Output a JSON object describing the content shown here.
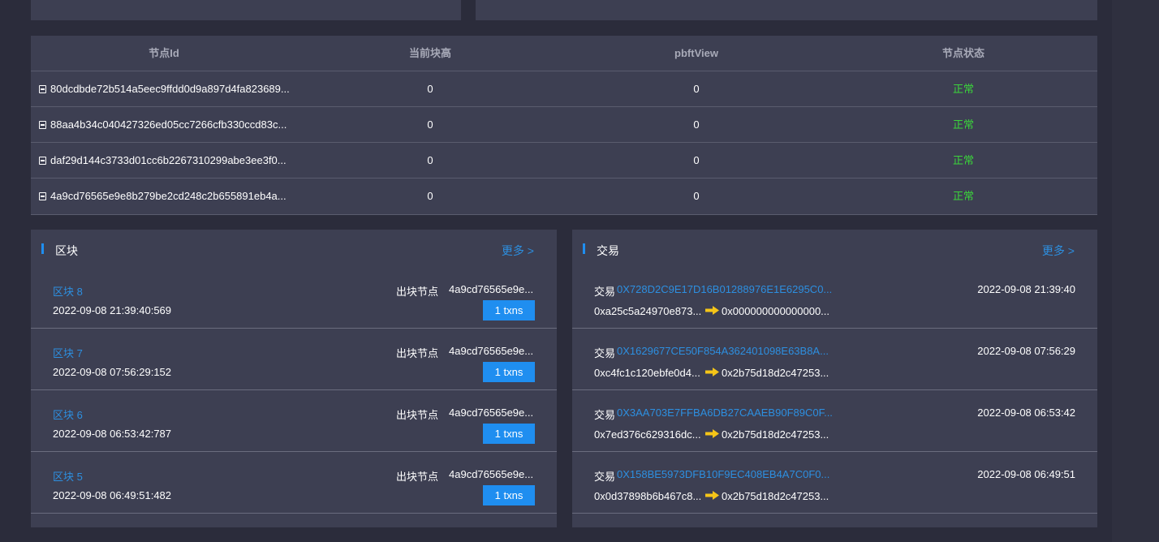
{
  "node_table": {
    "headers": [
      "节点Id",
      "当前块高",
      "pbftView",
      "节点状态"
    ],
    "rows": [
      {
        "id": "80dcdbde72b514a5eec9ffdd0d9a897d4fa823689...",
        "height": "0",
        "view": "0",
        "status": "正常"
      },
      {
        "id": "88aa4b34c040427326ed05cc7266cfb330ccd83c...",
        "height": "0",
        "view": "0",
        "status": "正常"
      },
      {
        "id": "daf29d144c3733d01cc6b2267310299abe3ee3f0...",
        "height": "0",
        "view": "0",
        "status": "正常"
      },
      {
        "id": "4a9cd76565e9e8b279be2cd248c2b655891eb4a...",
        "height": "0",
        "view": "0",
        "status": "正常"
      }
    ]
  },
  "blocks": {
    "title": "区块",
    "more": "更多 >",
    "miner_label": "出块节点",
    "items": [
      {
        "name": "区块 8",
        "time": "2022-09-08 21:39:40:569",
        "miner": "4a9cd76565e9e...",
        "txns": "1 txns"
      },
      {
        "name": "区块 7",
        "time": "2022-09-08 07:56:29:152",
        "miner": "4a9cd76565e9e...",
        "txns": "1 txns"
      },
      {
        "name": "区块 6",
        "time": "2022-09-08 06:53:42:787",
        "miner": "4a9cd76565e9e...",
        "txns": "1 txns"
      },
      {
        "name": "区块 5",
        "time": "2022-09-08 06:49:51:482",
        "miner": "4a9cd76565e9e...",
        "txns": "1 txns"
      }
    ]
  },
  "transactions": {
    "title": "交易",
    "more": "更多 >",
    "tx_label": "交易",
    "items": [
      {
        "hash": "0X728D2C9E17D16B01288976E1E6295C0...",
        "time": "2022-09-08 21:39:40",
        "from": "0xa25c5a24970e873...",
        "to": "0x000000000000000..."
      },
      {
        "hash": "0X1629677CE50F854A362401098E63B8A...",
        "time": "2022-09-08 07:56:29",
        "from": "0xc4fc1c120ebfe0d4...",
        "to": "0x2b75d18d2c47253..."
      },
      {
        "hash": "0X3AA703E7FFBA6DB27CAAEB90F89C0F...",
        "time": "2022-09-08 06:53:42",
        "from": "0x7ed376c629316dc...",
        "to": "0x2b75d18d2c47253..."
      },
      {
        "hash": "0X158BE5973DFB10F9EC408EB4A7C0F0...",
        "time": "2022-09-08 06:49:51",
        "from": "0x0d37898b6b467c8...",
        "to": "0x2b75d18d2c47253..."
      }
    ]
  },
  "colors": {
    "accent": "#1f8ef0",
    "link": "#2d8fe0",
    "ok": "#3bd43b",
    "arrow": "#f5c518",
    "panel": "#3d3f52",
    "background": "#2b2c3b"
  },
  "icons": {
    "node": "node-icon",
    "arrow": "arrow-right-icon"
  }
}
